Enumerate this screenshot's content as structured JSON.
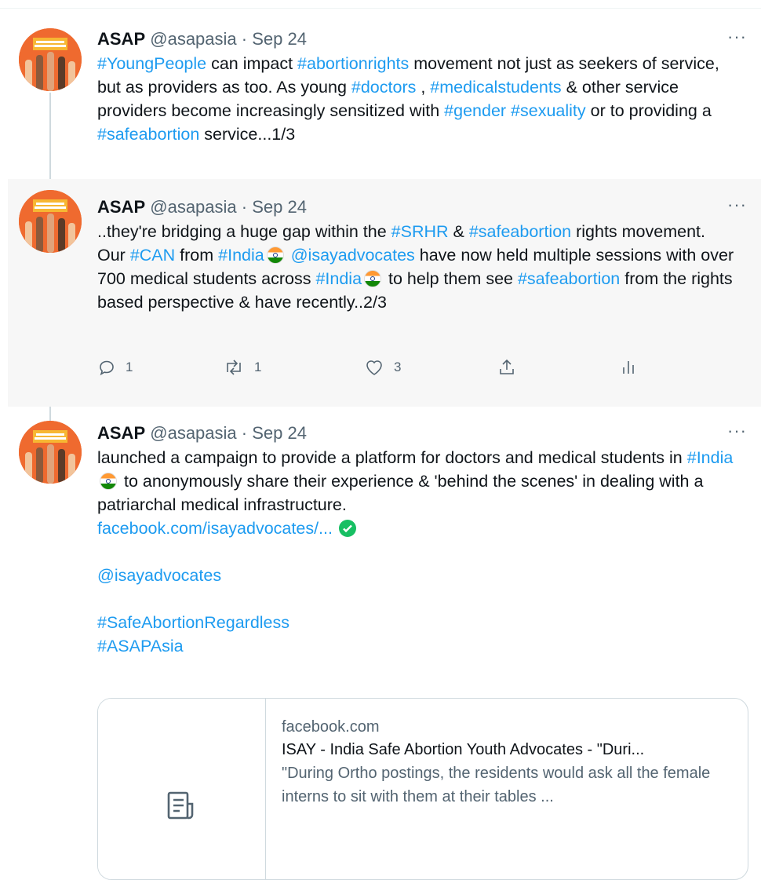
{
  "tweets": [
    {
      "name": "ASAP",
      "handle": "@asapasia",
      "date": "· Sep 24",
      "more_label": "···",
      "segments": [
        {
          "t": "#YoungPeople",
          "tag": true
        },
        {
          "t": " can impact ",
          "tag": false
        },
        {
          "t": "#abortionrights",
          "tag": true
        },
        {
          "t": " movement not just as seekers of service, but as providers as too. As young ",
          "tag": false
        },
        {
          "t": "#doctors",
          "tag": true
        },
        {
          "t": " , ",
          "tag": false
        },
        {
          "t": "#medicalstudents",
          "tag": true
        },
        {
          "t": " & other service providers become increasingly sensitized with ",
          "tag": false
        },
        {
          "t": "#gender",
          "tag": true
        },
        {
          "t": " ",
          "tag": false
        },
        {
          "t": "#sexuality",
          "tag": true
        },
        {
          "t": " or to providing a ",
          "tag": false
        },
        {
          "t": "#safeabortion",
          "tag": true
        },
        {
          "t": " service...1/3",
          "tag": false
        }
      ]
    },
    {
      "name": "ASAP",
      "handle": "@asapasia",
      "date": "· Sep 24",
      "more_label": "···",
      "segments": [
        {
          "t": "..they're bridging a huge gap within the ",
          "tag": false
        },
        {
          "t": "#SRHR",
          "tag": true
        },
        {
          "t": "  & ",
          "tag": false
        },
        {
          "t": "#safeabortion",
          "tag": true
        },
        {
          "t": " rights movement.",
          "tag": false
        },
        {
          "br": true
        },
        {
          "t": "Our ",
          "tag": false
        },
        {
          "t": "#CAN",
          "tag": true
        },
        {
          "t": " from ",
          "tag": false
        },
        {
          "t": "#India",
          "tag": true
        },
        {
          "flag": true
        },
        {
          "t": " ",
          "tag": false
        },
        {
          "t": "@isayadvocates",
          "tag": true
        },
        {
          "t": " have now held multiple sessions with over 700 medical students across ",
          "tag": false
        },
        {
          "t": "#India",
          "tag": true
        },
        {
          "flag": true
        },
        {
          "t": " to help them see ",
          "tag": false
        },
        {
          "t": "#safeabortion",
          "tag": true
        },
        {
          "t": " from the rights based perspective & have recently..2/3",
          "tag": false
        }
      ],
      "actions": {
        "reply_count": "1",
        "retweet_count": "1",
        "like_count": "3"
      }
    },
    {
      "name": "ASAP",
      "handle": "@asapasia",
      "date": "· Sep 24",
      "more_label": "···",
      "segments": [
        {
          "t": "launched a campaign to provide a platform for doctors and medical students in ",
          "tag": false
        },
        {
          "t": "#India",
          "tag": true
        },
        {
          "flag": true
        },
        {
          "t": " to anonymously share their experience & 'behind the scenes' in dealing with a patriarchal medical infrastructure.",
          "tag": false
        },
        {
          "br": true
        },
        {
          "t": "facebook.com/isayadvocates/...",
          "tag": true
        },
        {
          "verified": true
        },
        {
          "br": true
        },
        {
          "br": true
        },
        {
          "t": "@isayadvocates",
          "tag": true
        },
        {
          "br": true
        },
        {
          "br": true
        },
        {
          "t": "#SafeAbortionRegardless",
          "tag": true
        },
        {
          "br": true
        },
        {
          "t": "#ASAPAsia",
          "tag": true
        }
      ]
    }
  ],
  "link_card": {
    "domain": "facebook.com",
    "title": "ISAY - India Safe Abortion Youth Advocates - \"Duri...",
    "description": "\"During Ortho postings, the residents would ask all the female interns to sit with them at their tables ...",
    "icon": "article-icon"
  },
  "colors": {
    "link": "#1d9bf0",
    "muted": "#536471",
    "text": "#0f1419",
    "highlight_bg": "#f7f7f7",
    "avatar_bg": "#ef6a2f"
  }
}
